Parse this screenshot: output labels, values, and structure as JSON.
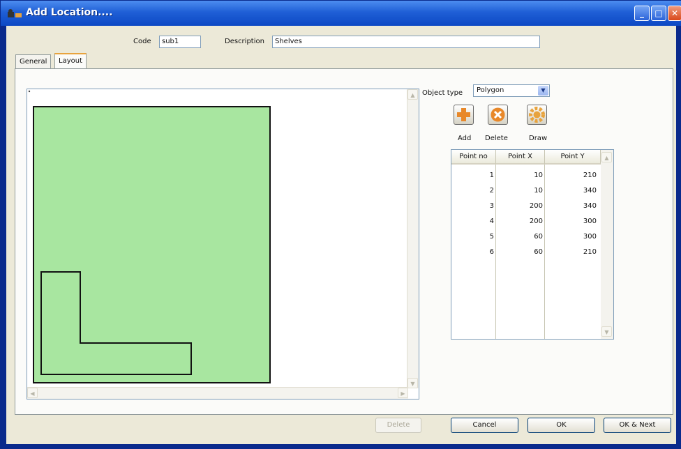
{
  "window": {
    "title": "Add Location...."
  },
  "header": {
    "code_label": "Code",
    "code_value": "sub1",
    "description_label": "Description",
    "description_value": "Shelves"
  },
  "tabs": [
    {
      "label": "General",
      "active": false
    },
    {
      "label": "Layout",
      "active": true
    }
  ],
  "layout": {
    "object_type_label": "Object type",
    "object_type_value": "Polygon",
    "tools": [
      {
        "label": "Add",
        "icon": "plus-icon"
      },
      {
        "label": "Delete",
        "icon": "x-icon"
      },
      {
        "label": "Draw",
        "icon": "gear-icon"
      }
    ],
    "points_table": {
      "columns": [
        "Point no",
        "Point X",
        "Point Y"
      ],
      "rows": [
        [
          "1",
          "10",
          "210"
        ],
        [
          "2",
          "10",
          "340"
        ],
        [
          "3",
          "200",
          "340"
        ],
        [
          "4",
          "200",
          "300"
        ],
        [
          "5",
          "60",
          "300"
        ],
        [
          "6",
          "60",
          "210"
        ]
      ]
    },
    "canvas": {
      "fill_color": "#a8e6a0",
      "stroke_color": "#111111"
    }
  },
  "footer": {
    "delete_label": "Delete",
    "cancel_label": "Cancel",
    "ok_label": "OK",
    "ok_next_label": "OK & Next"
  }
}
